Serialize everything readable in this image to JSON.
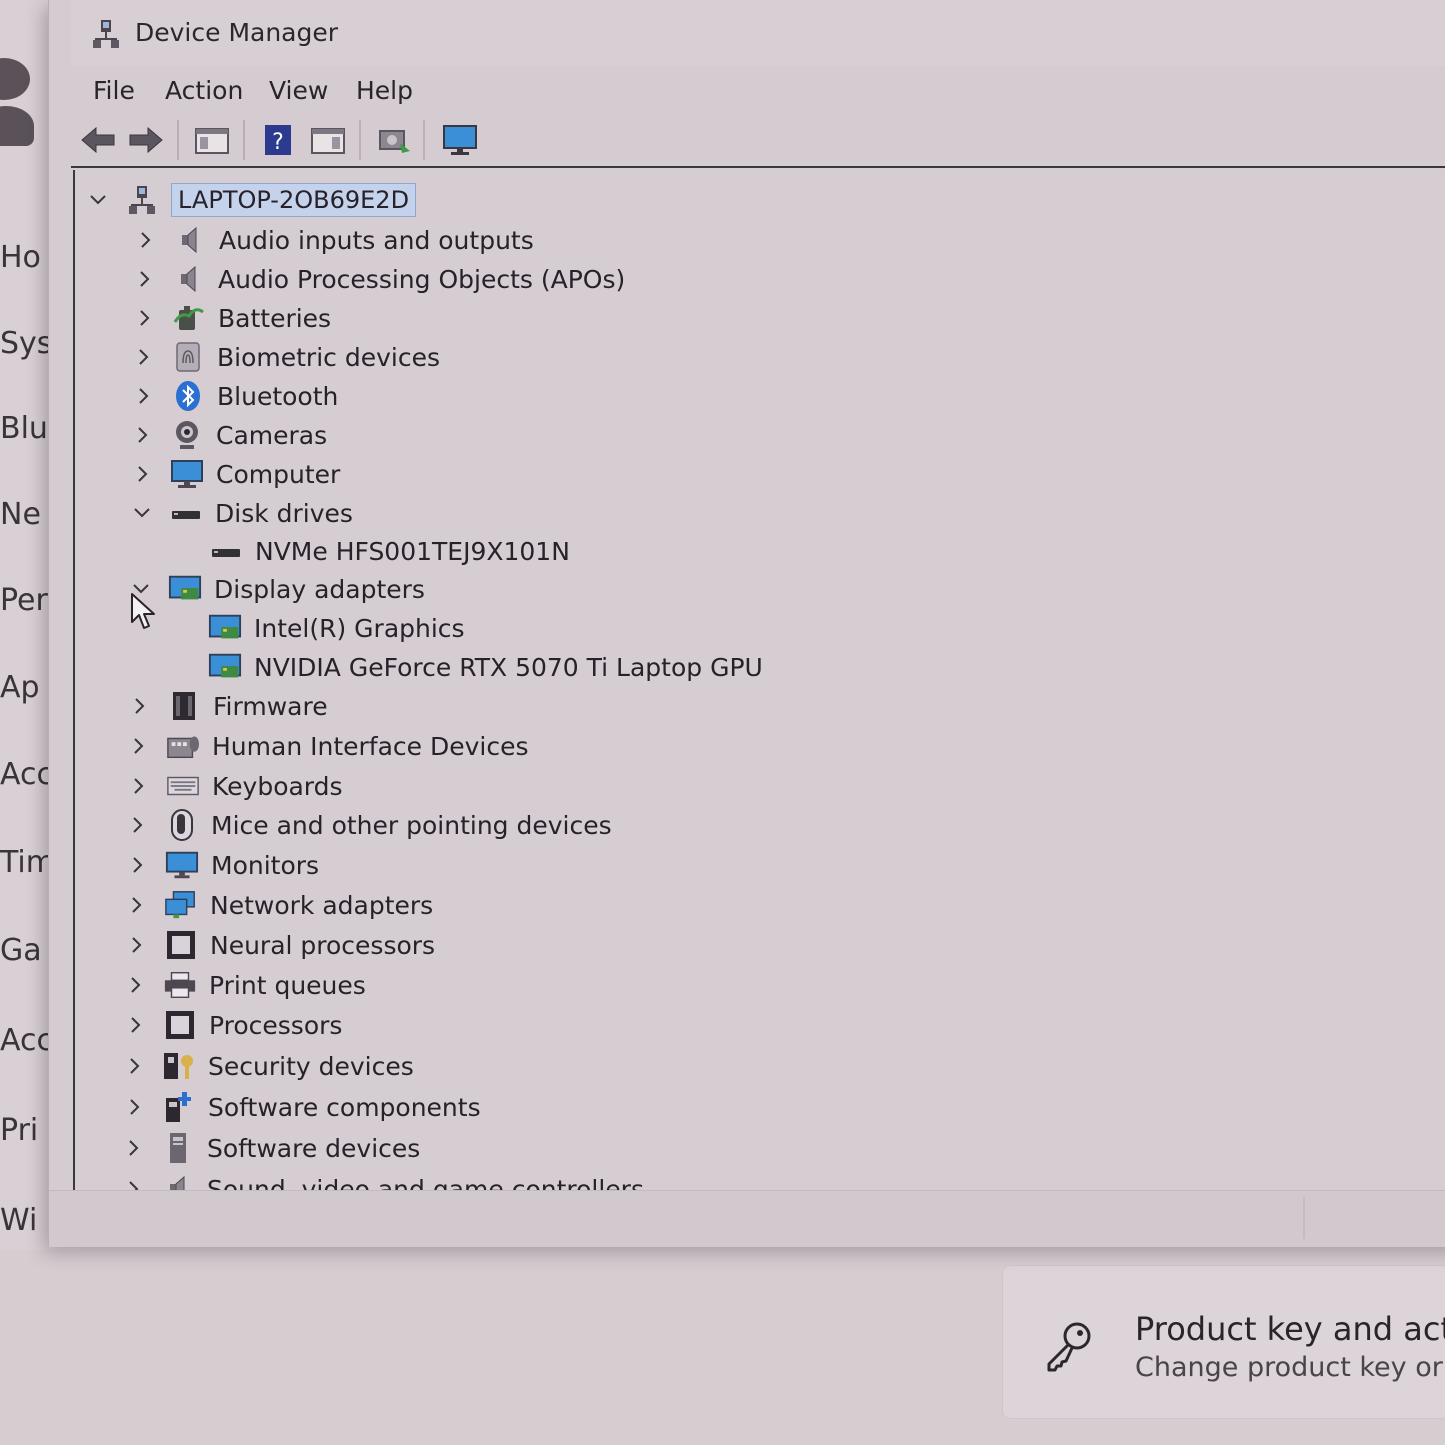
{
  "background_app": {
    "nav_fragments": [
      "Ho",
      "Sys",
      "Blu",
      "Ne",
      "Per",
      "Ap",
      "Acc",
      "Tim",
      "Ga",
      "Acc",
      "Pri",
      "Wi"
    ],
    "product_card": {
      "icon": "key-icon",
      "title": "Product key and activa",
      "subtitle": "Change product key or u"
    }
  },
  "window": {
    "title": "Device Manager",
    "icon": "device-manager-icon"
  },
  "menu": [
    "File",
    "Action",
    "View",
    "Help"
  ],
  "toolbar": [
    {
      "icon": "back-arrow-icon"
    },
    {
      "icon": "forward-arrow-icon"
    },
    {
      "icon": "show-hide-console-tree-icon"
    },
    {
      "icon": "help-icon"
    },
    {
      "icon": "properties-pane-icon"
    },
    {
      "icon": "scan-hardware-icon"
    },
    {
      "icon": "monitor-icon"
    }
  ],
  "tree": {
    "root": {
      "label": "LAPTOP-2OB69E2D",
      "expanded": true,
      "selected": true,
      "icon": "computer-network-icon"
    },
    "items": [
      {
        "label": "Audio inputs and outputs",
        "icon": "speaker-icon",
        "expanded": false
      },
      {
        "label": "Audio Processing Objects (APOs)",
        "icon": "speaker-icon",
        "expanded": false
      },
      {
        "label": "Batteries",
        "icon": "battery-icon",
        "expanded": false
      },
      {
        "label": "Biometric devices",
        "icon": "fingerprint-icon",
        "expanded": false
      },
      {
        "label": "Bluetooth",
        "icon": "bluetooth-icon",
        "expanded": false
      },
      {
        "label": "Cameras",
        "icon": "camera-icon",
        "expanded": false
      },
      {
        "label": "Computer",
        "icon": "computer-icon",
        "expanded": false
      },
      {
        "label": "Disk drives",
        "icon": "disk-drive-icon",
        "expanded": true,
        "children": [
          {
            "label": "NVMe HFS001TEJ9X101N",
            "icon": "disk-drive-icon"
          }
        ]
      },
      {
        "label": "Display adapters",
        "icon": "display-adapter-icon",
        "expanded": true,
        "children": [
          {
            "label": "Intel(R) Graphics",
            "icon": "display-adapter-icon"
          },
          {
            "label": "NVIDIA GeForce RTX 5070 Ti Laptop GPU",
            "icon": "display-adapter-icon"
          }
        ]
      },
      {
        "label": "Firmware",
        "icon": "firmware-icon",
        "expanded": false
      },
      {
        "label": "Human Interface Devices",
        "icon": "hid-icon",
        "expanded": false
      },
      {
        "label": "Keyboards",
        "icon": "keyboard-icon",
        "expanded": false
      },
      {
        "label": "Mice and other pointing devices",
        "icon": "mouse-icon",
        "expanded": false
      },
      {
        "label": "Monitors",
        "icon": "monitor-icon",
        "expanded": false
      },
      {
        "label": "Network adapters",
        "icon": "network-adapter-icon",
        "expanded": false
      },
      {
        "label": "Neural processors",
        "icon": "chip-icon",
        "expanded": false
      },
      {
        "label": "Print queues",
        "icon": "printer-icon",
        "expanded": false
      },
      {
        "label": "Processors",
        "icon": "chip-icon",
        "expanded": false
      },
      {
        "label": "Security devices",
        "icon": "security-device-icon",
        "expanded": false
      },
      {
        "label": "Software components",
        "icon": "software-component-icon",
        "expanded": false
      },
      {
        "label": "Software devices",
        "icon": "software-device-icon",
        "expanded": false
      },
      {
        "label": "Sound, video and game controllers",
        "icon": "speaker-icon",
        "expanded": false
      }
    ]
  }
}
